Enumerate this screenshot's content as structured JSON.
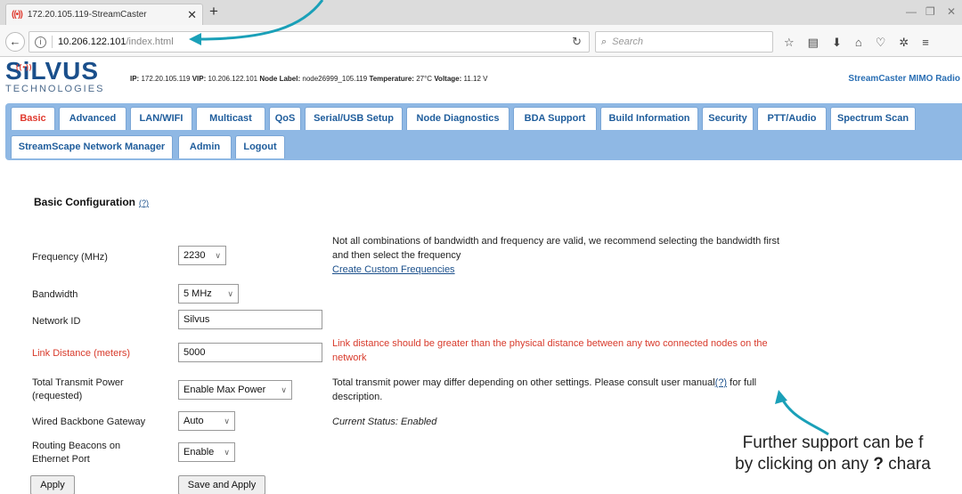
{
  "browser": {
    "tab_title": "172.20.105.119-StreamCaster",
    "url_host": "10.206.122.101",
    "url_path": "/index.html",
    "search_placeholder": "Search"
  },
  "header": {
    "logo_text": "SiLVUS",
    "logo_sub": "TECHNOLOGIES",
    "ip_label": "IP:",
    "ip": "172.20.105.119",
    "vip_label": "VIP:",
    "vip": "10.206.122.101",
    "node_label_label": "Node Label:",
    "node_label": "node26999_105.119",
    "temp_label": "Temperature:",
    "temp": "27°C",
    "voltage_label": "Voltage:",
    "voltage": "11.12 V",
    "product": "StreamCaster MIMO Radio"
  },
  "tabs": {
    "basic": "Basic",
    "advanced": "Advanced",
    "lan": "LAN/WIFI",
    "multicast": "Multicast",
    "qos": "QoS",
    "serial": "Serial/USB Setup",
    "diag": "Node Diagnostics",
    "bda": "BDA Support",
    "build": "Build Information",
    "security": "Security",
    "ptt": "PTT/Audio",
    "spectrum": "Spectrum Scan",
    "streamscape": "StreamScape Network Manager",
    "admin": "Admin",
    "logout": "Logout"
  },
  "form": {
    "title": "Basic Configuration",
    "help": "(?)",
    "frequency_label": "Frequency (MHz)",
    "frequency_value": "2230",
    "frequency_note1": "Not all combinations of bandwidth and frequency are valid, we recommend selecting the bandwidth first",
    "frequency_note2": "and then select the frequency",
    "custom_link": "Create Custom Frequencies",
    "bandwidth_label": "Bandwidth",
    "bandwidth_value": "5 MHz",
    "network_label": "Network ID",
    "network_value": "Silvus",
    "link_label": "Link Distance (meters)",
    "link_value": "5000",
    "link_note1": "Link distance should be greater than the physical distance between any two connected nodes on the",
    "link_note2": "network",
    "power_label1": "Total Transmit Power",
    "power_label2": "(requested)",
    "power_value": "Enable Max Power",
    "power_note1": "Total transmit power may differ depending on other settings. Please consult user manual",
    "power_note_help": "(?)",
    "power_note2": " for full",
    "power_note3": "description.",
    "gateway_label": "Wired Backbone Gateway",
    "gateway_value": "Auto",
    "gateway_status": "Current Status: Enabled",
    "beacons_label1": "Routing Beacons on",
    "beacons_label2": "Ethernet Port",
    "beacons_value": "Enable",
    "apply": "Apply",
    "save_apply": "Save and Apply"
  },
  "annotation": {
    "line1": "Further support can be f",
    "line2a": "by clicking on any ",
    "line2b": "?",
    "line2c": " chara"
  },
  "colors": {
    "brand": "#1a4f8b",
    "tabbar": "#8fb8e4",
    "accent_red": "#d83a2b",
    "arrow": "#1aa0b8"
  }
}
